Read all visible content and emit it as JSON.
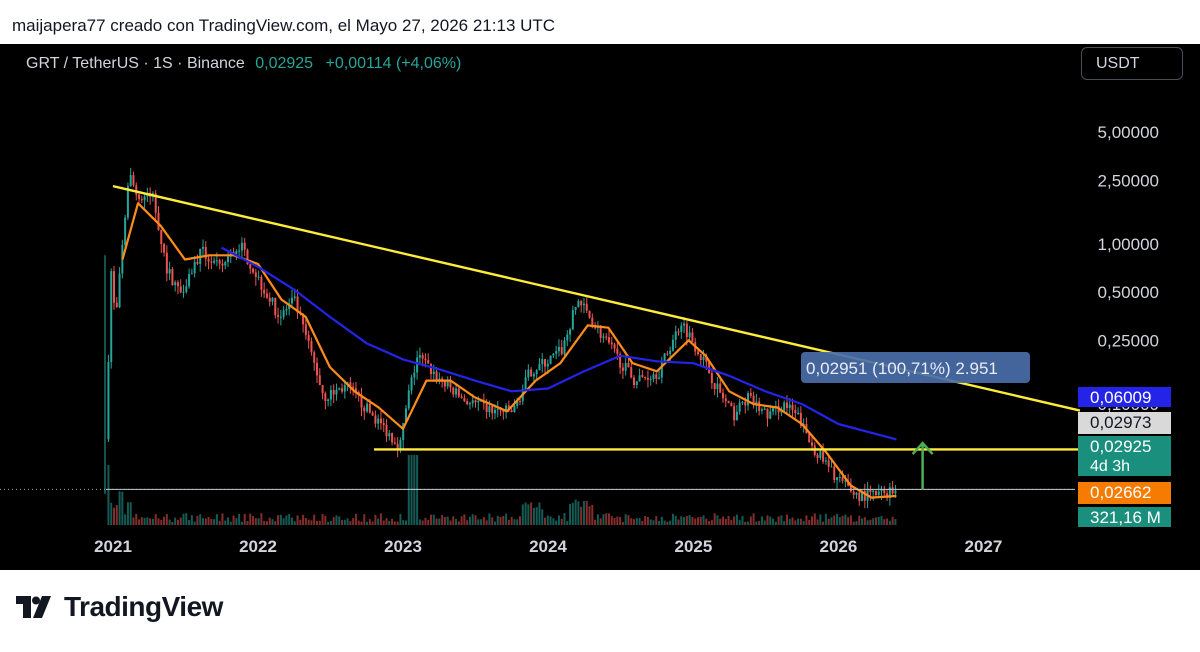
{
  "caption": "maijapera77 creado con TradingView.com, el Mayo 27, 2026 21:13 UTC",
  "header": {
    "symbol": "GRT / TetherUS · 1S · Binance",
    "price": "0,02925",
    "change": "+0,00114 (+4,06%)",
    "currency_button": "USDT"
  },
  "brand": {
    "name": "TradingView"
  },
  "colors": {
    "background": "#000000",
    "up": "#26a69a",
    "down": "#ef5350",
    "trendline": "#ffeb3b",
    "ma_fast": "#ff8c1a",
    "ma_slow": "#2424e8",
    "target_arrow": "#4caf50",
    "measure_box": "#4a6ea8"
  },
  "chart_data": {
    "type": "candlestick",
    "scale": "log",
    "x_ticks": [
      "2021",
      "2022",
      "2023",
      "2024",
      "2025",
      "2026",
      "2027"
    ],
    "y_ticks": [
      "5,00000",
      "2,50000",
      "1,00000",
      "0,50000",
      "0,25000",
      "0,10000"
    ],
    "price_path": [
      [
        "2020-12-17",
        0.06
      ],
      [
        "2021-01-01",
        0.8
      ],
      [
        "2021-01-10",
        0.3
      ],
      [
        "2021-02-10",
        2.2
      ],
      [
        "2021-02-13",
        2.8
      ],
      [
        "2021-03-10",
        1.9
      ],
      [
        "2021-04-15",
        2.0
      ],
      [
        "2021-05-20",
        0.7
      ],
      [
        "2021-06-22",
        0.5
      ],
      [
        "2021-08-15",
        0.9
      ],
      [
        "2021-09-30",
        0.7
      ],
      [
        "2021-11-20",
        1.0
      ],
      [
        "2022-01-15",
        0.55
      ],
      [
        "2022-03-01",
        0.35
      ],
      [
        "2022-04-05",
        0.45
      ],
      [
        "2022-05-15",
        0.22
      ],
      [
        "2022-06-20",
        0.11
      ],
      [
        "2022-08-15",
        0.13
      ],
      [
        "2022-10-20",
        0.085
      ],
      [
        "2022-12-28",
        0.055
      ],
      [
        "2023-01-20",
        0.12
      ],
      [
        "2023-02-10",
        0.2
      ],
      [
        "2023-04-10",
        0.14
      ],
      [
        "2023-06-10",
        0.105
      ],
      [
        "2023-08-20",
        0.09
      ],
      [
        "2023-10-10",
        0.09
      ],
      [
        "2023-11-20",
        0.16
      ],
      [
        "2024-01-10",
        0.19
      ],
      [
        "2024-02-10",
        0.22
      ],
      [
        "2024-03-20",
        0.45
      ],
      [
        "2024-05-05",
        0.3
      ],
      [
        "2024-07-01",
        0.19
      ],
      [
        "2024-08-10",
        0.14
      ],
      [
        "2024-10-10",
        0.16
      ],
      [
        "2024-12-05",
        0.33
      ],
      [
        "2025-01-20",
        0.21
      ],
      [
        "2025-03-10",
        0.12
      ],
      [
        "2025-04-15",
        0.085
      ],
      [
        "2025-05-20",
        0.11
      ],
      [
        "2025-07-10",
        0.085
      ],
      [
        "2025-08-20",
        0.1
      ],
      [
        "2025-09-30",
        0.08
      ],
      [
        "2025-10-20",
        0.06
      ],
      [
        "2025-12-10",
        0.04
      ],
      [
        "2026-01-20",
        0.031
      ],
      [
        "2026-02-20",
        0.027
      ],
      [
        "2026-04-10",
        0.027
      ],
      [
        "2026-05-27",
        0.02925
      ]
    ],
    "series": [
      {
        "values": [
          [
            "2021-01-25",
            0.8
          ],
          [
            "2021-03-05",
            1.8
          ],
          [
            "2021-05-01",
            1.3
          ],
          [
            "2021-07-01",
            0.8
          ],
          [
            "2021-09-01",
            0.85
          ],
          [
            "2021-11-01",
            0.85
          ],
          [
            "2022-01-01",
            0.75
          ],
          [
            "2022-03-01",
            0.45
          ],
          [
            "2022-05-01",
            0.35
          ],
          [
            "2022-07-01",
            0.17
          ],
          [
            "2022-09-01",
            0.12
          ],
          [
            "2022-11-01",
            0.095
          ],
          [
            "2023-01-01",
            0.07
          ],
          [
            "2023-03-01",
            0.14
          ],
          [
            "2023-05-01",
            0.14
          ],
          [
            "2023-07-01",
            0.11
          ],
          [
            "2023-09-20",
            0.09
          ],
          [
            "2023-12-01",
            0.14
          ],
          [
            "2024-02-01",
            0.18
          ],
          [
            "2024-04-10",
            0.31
          ],
          [
            "2024-06-01",
            0.3
          ],
          [
            "2024-08-01",
            0.18
          ],
          [
            "2024-10-01",
            0.16
          ],
          [
            "2024-12-20",
            0.25
          ],
          [
            "2025-02-01",
            0.2
          ],
          [
            "2025-04-01",
            0.12
          ],
          [
            "2025-06-01",
            0.1
          ],
          [
            "2025-08-01",
            0.095
          ],
          [
            "2025-10-01",
            0.075
          ],
          [
            "2025-12-01",
            0.05
          ],
          [
            "2026-02-01",
            0.031
          ],
          [
            "2026-03-25",
            0.026
          ],
          [
            "2026-05-27",
            0.02662
          ]
        ]
      },
      {
        "values": [
          [
            "2021-10-01",
            0.95
          ],
          [
            "2022-01-01",
            0.72
          ],
          [
            "2022-04-01",
            0.52
          ],
          [
            "2022-07-01",
            0.35
          ],
          [
            "2022-10-01",
            0.24
          ],
          [
            "2023-01-01",
            0.19
          ],
          [
            "2023-04-01",
            0.165
          ],
          [
            "2023-07-01",
            0.14
          ],
          [
            "2023-10-01",
            0.12
          ],
          [
            "2024-01-01",
            0.125
          ],
          [
            "2024-04-01",
            0.16
          ],
          [
            "2024-07-01",
            0.2
          ],
          [
            "2024-10-01",
            0.185
          ],
          [
            "2025-01-01",
            0.18
          ],
          [
            "2025-04-01",
            0.15
          ],
          [
            "2025-07-01",
            0.12
          ],
          [
            "2025-10-01",
            0.1
          ],
          [
            "2026-01-01",
            0.075
          ],
          [
            "2026-05-27",
            0.06009
          ]
        ]
      }
    ],
    "trendlines": [
      {
        "start": [
          "2021-01-01",
          2.3
        ],
        "end": [
          "2027-09-01",
          0.091
        ]
      },
      {
        "start": [
          "2022-10-20",
          0.052
        ],
        "end": [
          "2027-09-01",
          0.052
        ]
      }
    ],
    "current_price_line": 0.02925,
    "target_arrow": {
      "date": "2026-08-01",
      "from": 0.02925,
      "to": 0.057
    },
    "measure_label": "0,02951 (100,71%) 2.951",
    "price_labels": [
      {
        "text": "0,06009",
        "sub": "",
        "bg": "#2424e8",
        "fg": "#ffffff"
      },
      {
        "text": "0,02973",
        "sub": "",
        "bg": "#d9d9d9",
        "fg": "#131722"
      },
      {
        "text": "0,02925",
        "sub": "4d 3h",
        "bg": "#1a8f7e",
        "fg": "#ffffff"
      },
      {
        "text": "0,02662",
        "sub": "",
        "bg": "#f57c00",
        "fg": "#ffffff"
      },
      {
        "text": "321,16 M",
        "sub": "",
        "bg": "#1a8f7e",
        "fg": "#ffffff"
      }
    ]
  }
}
